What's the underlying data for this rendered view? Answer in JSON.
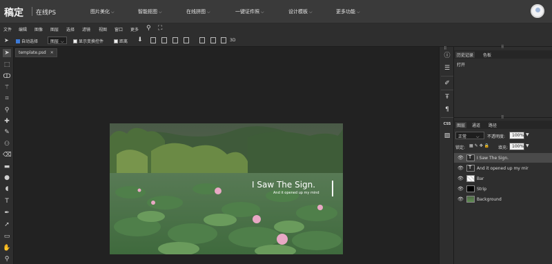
{
  "header": {
    "logo": "稿定",
    "logo_sub": "在线PS",
    "nav": [
      {
        "label": "图片美化"
      },
      {
        "label": "智能抠图"
      },
      {
        "label": "在线拼图"
      },
      {
        "label": "一键证件照"
      },
      {
        "label": "设计模板"
      },
      {
        "label": "更多功能"
      }
    ]
  },
  "menu": [
    "文件",
    "编辑",
    "图像",
    "图层",
    "选择",
    "滤镜",
    "视图",
    "窗口",
    "更多"
  ],
  "options": {
    "auto_select": "自动选择",
    "target": "图层",
    "show_transform": "显示变换控件",
    "spacing": "距离",
    "mode_3d": "3D"
  },
  "document": {
    "tab_title": "template.psd",
    "overlay_title": "I Saw The Sign.",
    "overlay_subtitle": "And it opened up my mind"
  },
  "right_strip": {
    "css_label": "CSS"
  },
  "history": {
    "tabs": [
      "历史记录",
      "色板"
    ],
    "items": [
      "打开"
    ]
  },
  "layers": {
    "tabs": [
      "图层",
      "通道",
      "路径"
    ],
    "blend_mode": "正常",
    "opacity_label": "不透明度:",
    "opacity": "100%",
    "lock_label": "锁定:",
    "fill_label": "填充:",
    "fill": "100%",
    "items": [
      {
        "name": "I Saw The Sign.",
        "selected": true
      },
      {
        "name": "And it opened up my mir",
        "selected": false
      },
      {
        "name": "Bar",
        "selected": false
      },
      {
        "name": "Strip",
        "selected": false
      },
      {
        "name": "Background",
        "selected": false
      }
    ]
  },
  "colors": {
    "accent": "#3d7bd9",
    "header_bg": "#3a3a3a",
    "panel_bg": "#2e2e2e"
  }
}
